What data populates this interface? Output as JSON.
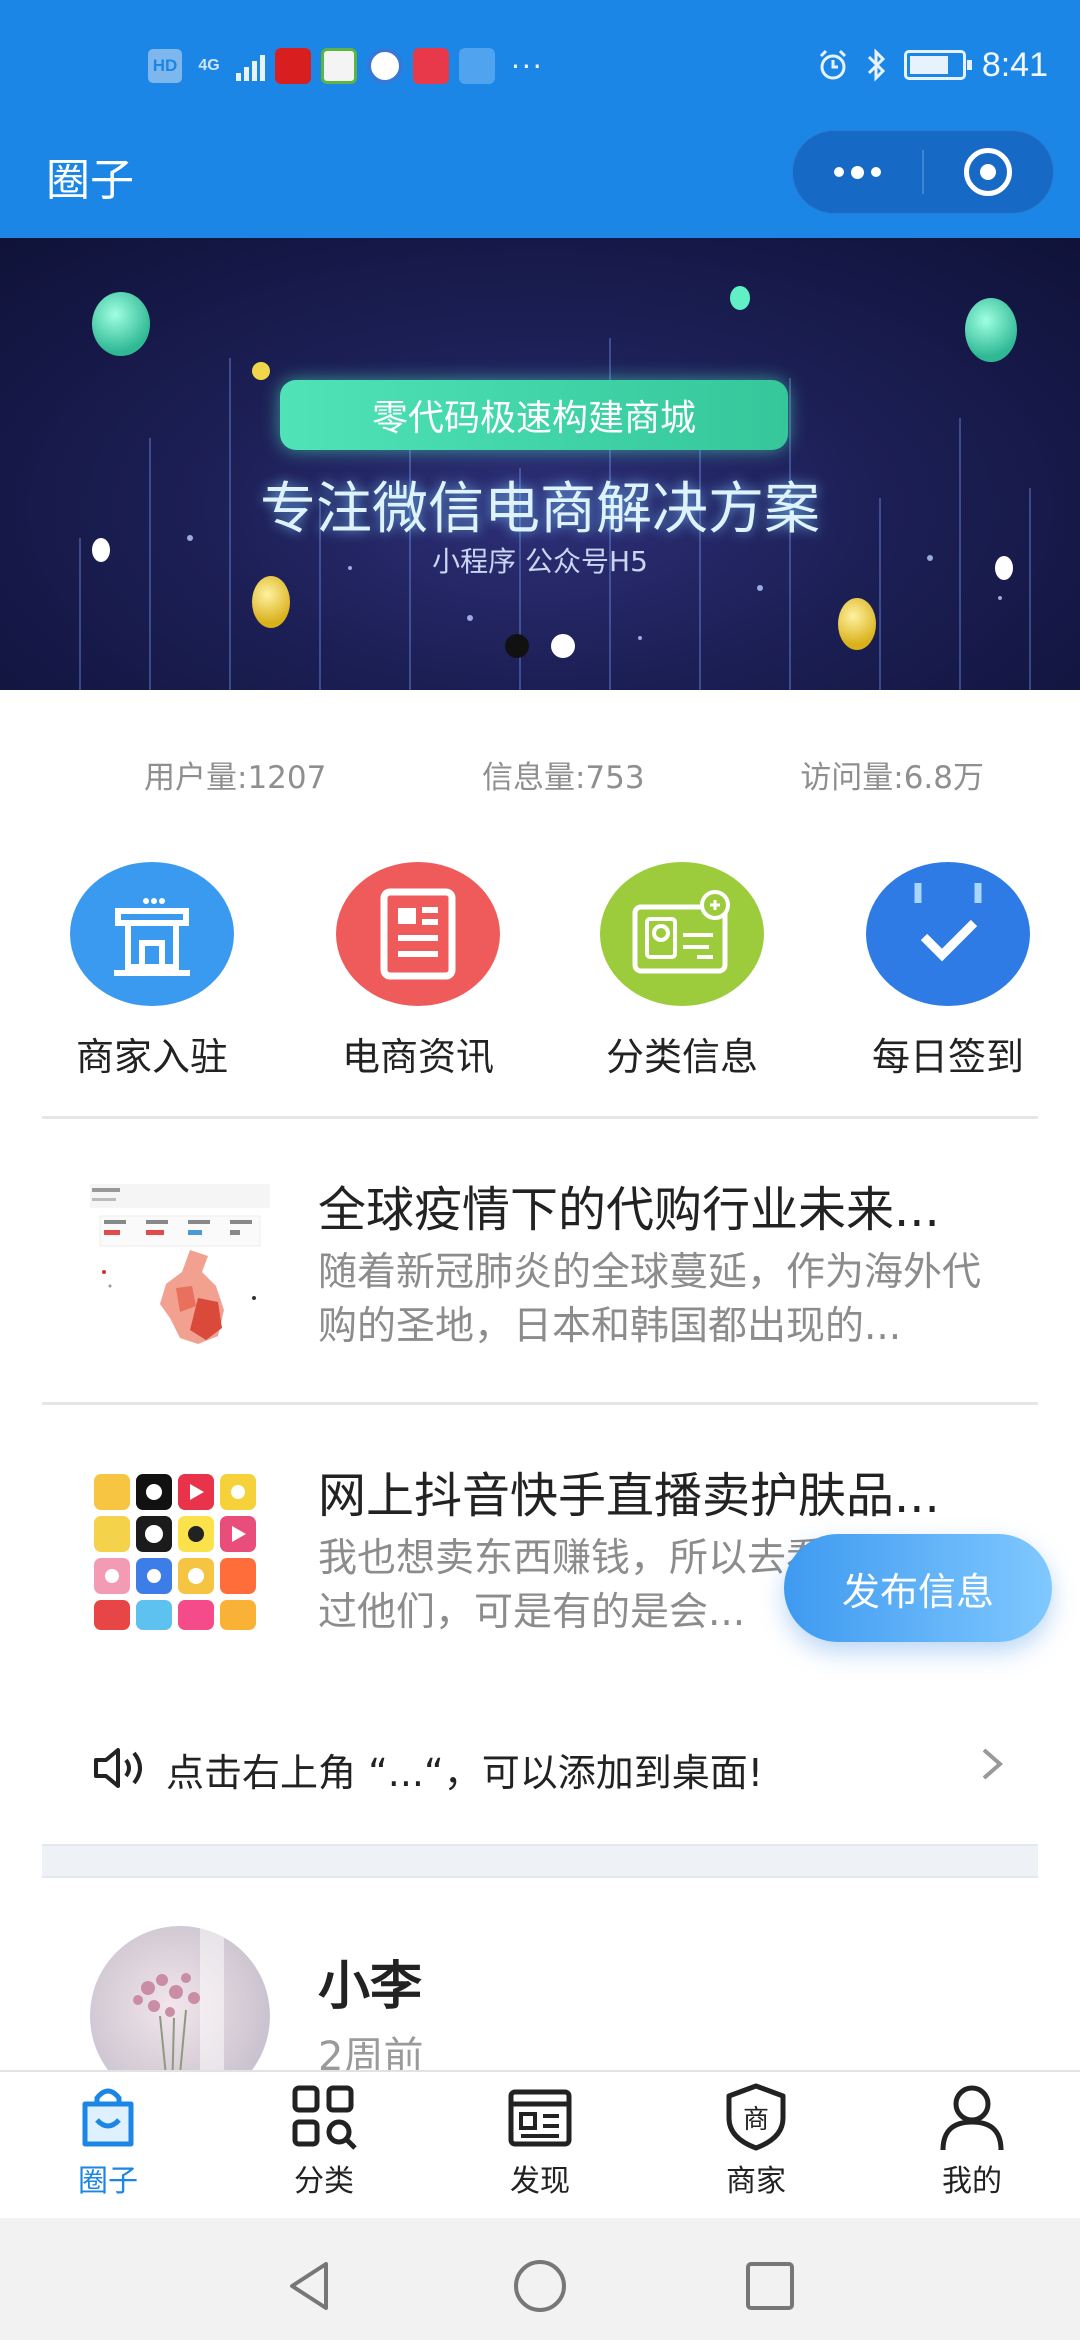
{
  "status_bar": {
    "hd": "HD",
    "network": "4G",
    "time": "8:41",
    "more_dots": "···"
  },
  "header": {
    "title": "圈子"
  },
  "banner": {
    "pill": "零代码极速构建商城",
    "headline": "专注微信电商解决方案",
    "sub": "小程序 公众号H5",
    "slides": 2,
    "active_slide": 1
  },
  "stats": {
    "users": "用户量:1207",
    "posts": "信息量:753",
    "visits": "访问量:6.8万"
  },
  "quick_actions": [
    {
      "label": "商家入驻",
      "icon": "storefront-icon",
      "color": "#3a9af0"
    },
    {
      "label": "电商资讯",
      "icon": "news-icon",
      "color": "#ef5b5b"
    },
    {
      "label": "分类信息",
      "icon": "id-card-icon",
      "color": "#9ccc3c"
    },
    {
      "label": "每日签到",
      "icon": "calendar-check-icon",
      "color": "#2e7be6"
    }
  ],
  "articles": [
    {
      "title": "全球疫情下的代购行业未来...",
      "desc": "随着新冠肺炎的全球蔓延，作为海外代购的圣地，日本和韩国都出现的..."
    },
    {
      "title": "网上抖音快手直播卖护肤品...",
      "desc": "我也想卖东西赚钱，所以去看了直播找过他们，可是有的是会..."
    }
  ],
  "notice": {
    "text": "点击右上角 “...“，可以添加到桌面!"
  },
  "post": {
    "name": "小李",
    "time": "2周前"
  },
  "fab": {
    "label": "发布信息"
  },
  "tabs": [
    {
      "label": "圈子",
      "icon": "bag-icon",
      "active": true
    },
    {
      "label": "分类",
      "icon": "category-search-icon",
      "active": false
    },
    {
      "label": "发现",
      "icon": "discover-icon",
      "active": false
    },
    {
      "label": "商家",
      "icon": "merchant-shield-icon",
      "active": false
    },
    {
      "label": "我的",
      "icon": "user-icon",
      "active": false
    }
  ],
  "colors": {
    "brand": "#1b86e6",
    "fab_start": "#3e9af0",
    "fab_end": "#80c8ff"
  }
}
